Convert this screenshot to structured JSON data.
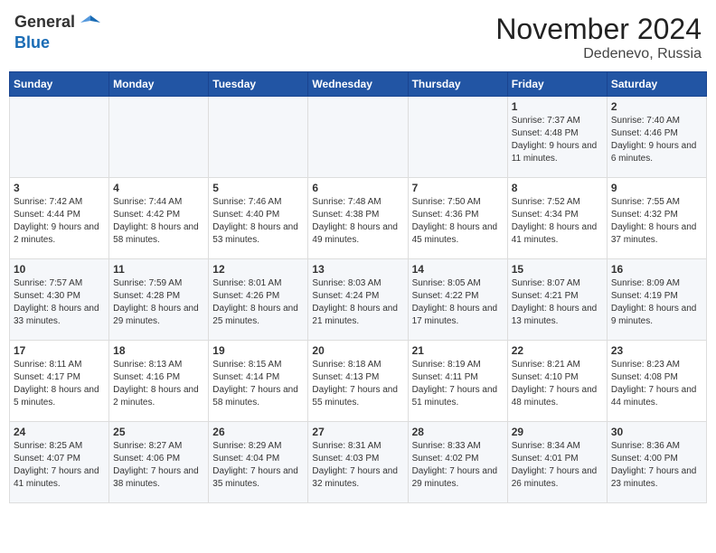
{
  "header": {
    "logo_general": "General",
    "logo_blue": "Blue",
    "month": "November 2024",
    "location": "Dedenevo, Russia"
  },
  "days_of_week": [
    "Sunday",
    "Monday",
    "Tuesday",
    "Wednesday",
    "Thursday",
    "Friday",
    "Saturday"
  ],
  "weeks": [
    [
      {
        "day": "",
        "info": ""
      },
      {
        "day": "",
        "info": ""
      },
      {
        "day": "",
        "info": ""
      },
      {
        "day": "",
        "info": ""
      },
      {
        "day": "",
        "info": ""
      },
      {
        "day": "1",
        "info": "Sunrise: 7:37 AM\nSunset: 4:48 PM\nDaylight: 9 hours and 11 minutes."
      },
      {
        "day": "2",
        "info": "Sunrise: 7:40 AM\nSunset: 4:46 PM\nDaylight: 9 hours and 6 minutes."
      }
    ],
    [
      {
        "day": "3",
        "info": "Sunrise: 7:42 AM\nSunset: 4:44 PM\nDaylight: 9 hours and 2 minutes."
      },
      {
        "day": "4",
        "info": "Sunrise: 7:44 AM\nSunset: 4:42 PM\nDaylight: 8 hours and 58 minutes."
      },
      {
        "day": "5",
        "info": "Sunrise: 7:46 AM\nSunset: 4:40 PM\nDaylight: 8 hours and 53 minutes."
      },
      {
        "day": "6",
        "info": "Sunrise: 7:48 AM\nSunset: 4:38 PM\nDaylight: 8 hours and 49 minutes."
      },
      {
        "day": "7",
        "info": "Sunrise: 7:50 AM\nSunset: 4:36 PM\nDaylight: 8 hours and 45 minutes."
      },
      {
        "day": "8",
        "info": "Sunrise: 7:52 AM\nSunset: 4:34 PM\nDaylight: 8 hours and 41 minutes."
      },
      {
        "day": "9",
        "info": "Sunrise: 7:55 AM\nSunset: 4:32 PM\nDaylight: 8 hours and 37 minutes."
      }
    ],
    [
      {
        "day": "10",
        "info": "Sunrise: 7:57 AM\nSunset: 4:30 PM\nDaylight: 8 hours and 33 minutes."
      },
      {
        "day": "11",
        "info": "Sunrise: 7:59 AM\nSunset: 4:28 PM\nDaylight: 8 hours and 29 minutes."
      },
      {
        "day": "12",
        "info": "Sunrise: 8:01 AM\nSunset: 4:26 PM\nDaylight: 8 hours and 25 minutes."
      },
      {
        "day": "13",
        "info": "Sunrise: 8:03 AM\nSunset: 4:24 PM\nDaylight: 8 hours and 21 minutes."
      },
      {
        "day": "14",
        "info": "Sunrise: 8:05 AM\nSunset: 4:22 PM\nDaylight: 8 hours and 17 minutes."
      },
      {
        "day": "15",
        "info": "Sunrise: 8:07 AM\nSunset: 4:21 PM\nDaylight: 8 hours and 13 minutes."
      },
      {
        "day": "16",
        "info": "Sunrise: 8:09 AM\nSunset: 4:19 PM\nDaylight: 8 hours and 9 minutes."
      }
    ],
    [
      {
        "day": "17",
        "info": "Sunrise: 8:11 AM\nSunset: 4:17 PM\nDaylight: 8 hours and 5 minutes."
      },
      {
        "day": "18",
        "info": "Sunrise: 8:13 AM\nSunset: 4:16 PM\nDaylight: 8 hours and 2 minutes."
      },
      {
        "day": "19",
        "info": "Sunrise: 8:15 AM\nSunset: 4:14 PM\nDaylight: 7 hours and 58 minutes."
      },
      {
        "day": "20",
        "info": "Sunrise: 8:18 AM\nSunset: 4:13 PM\nDaylight: 7 hours and 55 minutes."
      },
      {
        "day": "21",
        "info": "Sunrise: 8:19 AM\nSunset: 4:11 PM\nDaylight: 7 hours and 51 minutes."
      },
      {
        "day": "22",
        "info": "Sunrise: 8:21 AM\nSunset: 4:10 PM\nDaylight: 7 hours and 48 minutes."
      },
      {
        "day": "23",
        "info": "Sunrise: 8:23 AM\nSunset: 4:08 PM\nDaylight: 7 hours and 44 minutes."
      }
    ],
    [
      {
        "day": "24",
        "info": "Sunrise: 8:25 AM\nSunset: 4:07 PM\nDaylight: 7 hours and 41 minutes."
      },
      {
        "day": "25",
        "info": "Sunrise: 8:27 AM\nSunset: 4:06 PM\nDaylight: 7 hours and 38 minutes."
      },
      {
        "day": "26",
        "info": "Sunrise: 8:29 AM\nSunset: 4:04 PM\nDaylight: 7 hours and 35 minutes."
      },
      {
        "day": "27",
        "info": "Sunrise: 8:31 AM\nSunset: 4:03 PM\nDaylight: 7 hours and 32 minutes."
      },
      {
        "day": "28",
        "info": "Sunrise: 8:33 AM\nSunset: 4:02 PM\nDaylight: 7 hours and 29 minutes."
      },
      {
        "day": "29",
        "info": "Sunrise: 8:34 AM\nSunset: 4:01 PM\nDaylight: 7 hours and 26 minutes."
      },
      {
        "day": "30",
        "info": "Sunrise: 8:36 AM\nSunset: 4:00 PM\nDaylight: 7 hours and 23 minutes."
      }
    ]
  ]
}
